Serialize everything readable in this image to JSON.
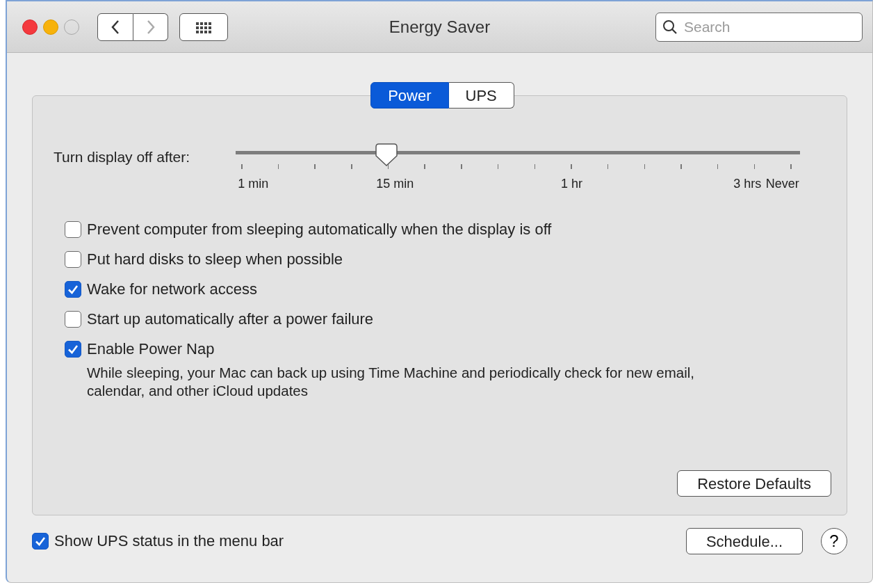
{
  "window": {
    "title": "Energy Saver"
  },
  "search": {
    "placeholder": "Search"
  },
  "tabs": [
    {
      "label": "Power",
      "selected": true
    },
    {
      "label": "UPS",
      "selected": false
    }
  ],
  "slider": {
    "label": "Turn display off after:",
    "level": 0.267,
    "tick_labels": [
      "1 min",
      "15 min",
      "1 hr",
      "3 hrs",
      "Never"
    ]
  },
  "options": [
    {
      "label": "Prevent computer from sleeping automatically when the display is off",
      "checked": false
    },
    {
      "label": "Put hard disks to sleep when possible",
      "checked": false
    },
    {
      "label": "Wake for network access",
      "checked": true
    },
    {
      "label": "Start up automatically after a power failure",
      "checked": false
    },
    {
      "label": "Enable Power Nap",
      "checked": true,
      "description": "While sleeping, your Mac can back up using Time Machine and periodically check for new email, calendar, and other iCloud updates"
    }
  ],
  "restore_button": "Restore Defaults",
  "ups_status": {
    "label": "Show UPS status in the menu bar",
    "checked": true
  },
  "schedule_button": "Schedule...",
  "help_button": "?"
}
